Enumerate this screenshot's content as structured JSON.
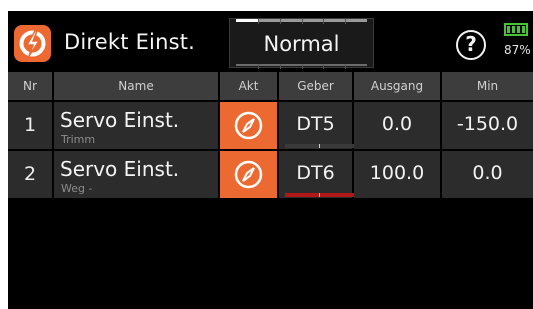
{
  "header": {
    "title": "Direkt Einst.",
    "mode_label": "Normal",
    "mode_level": 0.17,
    "help_label": "?",
    "battery_percent": "87%",
    "icons": {
      "app": "app-logo-icon",
      "help": "help-icon",
      "battery": "battery-icon"
    }
  },
  "colors": {
    "accent": "#ec6a31",
    "battery": "#49c23a",
    "header_bg": "#3d3d3d",
    "row_bg": "#2c2c2c"
  },
  "table": {
    "columns": [
      "Nr",
      "Name",
      "Akt",
      "Geber",
      "Ausgang",
      "Min"
    ],
    "rows": [
      {
        "nr": "1",
        "name": "Servo Einst.",
        "sub": "Trimm",
        "akt_icon": "compass-icon",
        "geber": "DT5",
        "geber_bar": "gray",
        "ausgang": "0.0",
        "min": "-150.0"
      },
      {
        "nr": "2",
        "name": "Servo Einst.",
        "sub": "Weg -",
        "akt_icon": "compass-icon",
        "geber": "DT6",
        "geber_bar": "red",
        "ausgang": "100.0",
        "min": "0.0"
      }
    ]
  }
}
